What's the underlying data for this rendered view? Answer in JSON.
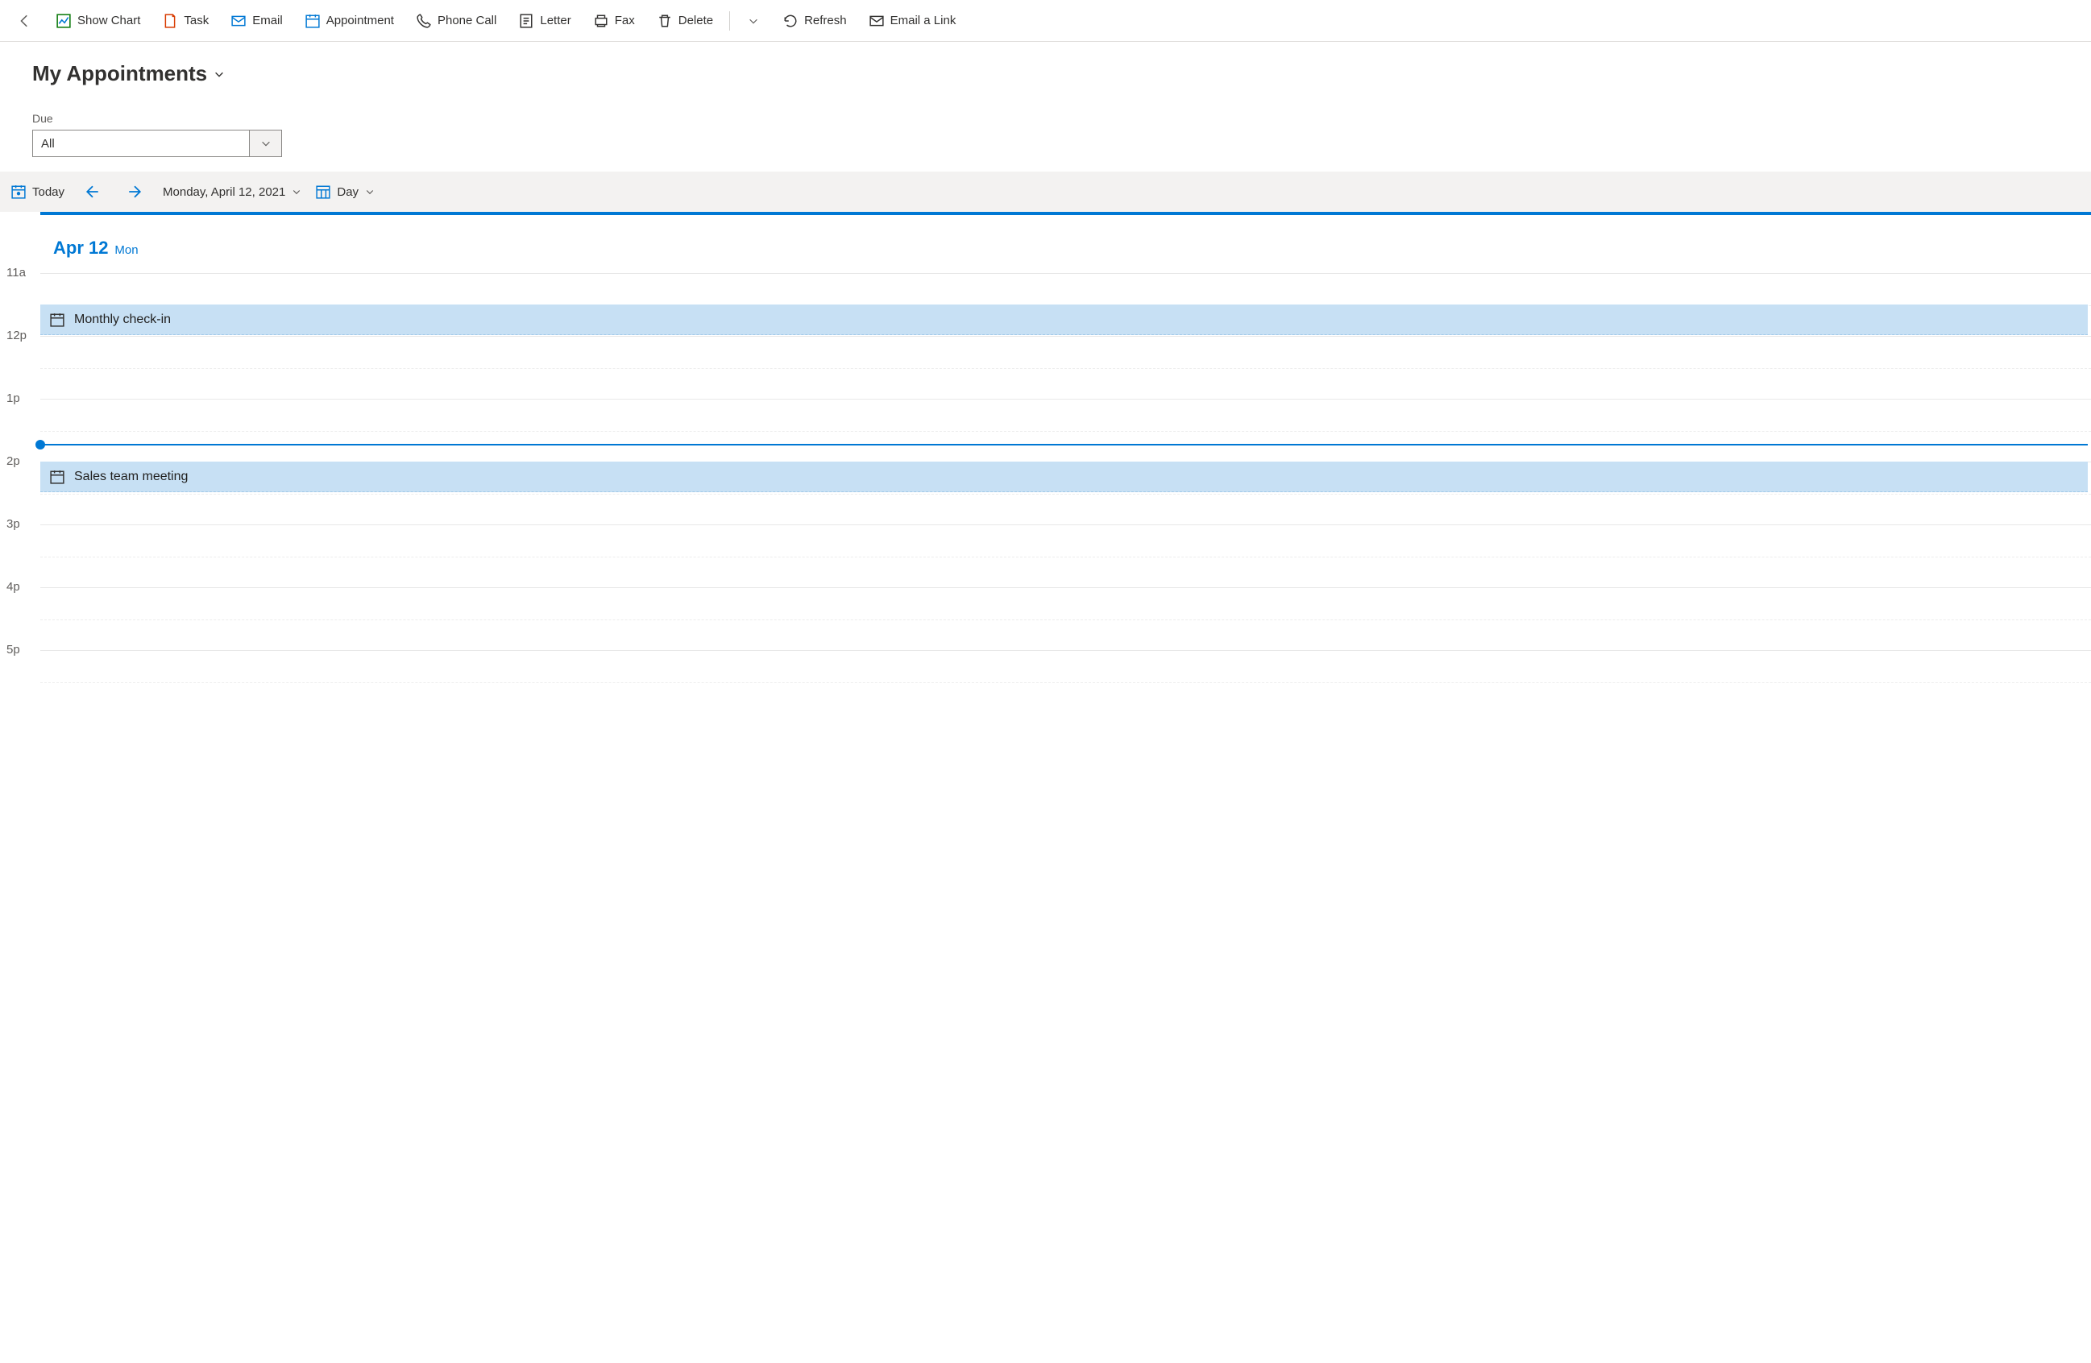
{
  "toolbar": {
    "show_chart": "Show Chart",
    "task": "Task",
    "email": "Email",
    "appointment": "Appointment",
    "phone_call": "Phone Call",
    "letter": "Letter",
    "fax": "Fax",
    "delete": "Delete",
    "refresh": "Refresh",
    "email_link": "Email a Link"
  },
  "page_title": "My Appointments",
  "filter": {
    "label": "Due",
    "value": "All"
  },
  "datebar": {
    "today": "Today",
    "date_text": "Monday, April 12, 2021",
    "view": "Day"
  },
  "day_header": {
    "date": "Apr 12",
    "weekday": "Mon"
  },
  "hours": [
    "11a",
    "12p",
    "1p",
    "2p",
    "3p",
    "4p",
    "5p"
  ],
  "events": [
    {
      "title": "Monthly check-in",
      "start_hour_index": 0,
      "start_half": true
    },
    {
      "title": "Sales team meeting",
      "start_hour_index": 3,
      "start_half": false
    }
  ],
  "now_indicator": {
    "hour_index": 2,
    "fraction": 0.72
  }
}
